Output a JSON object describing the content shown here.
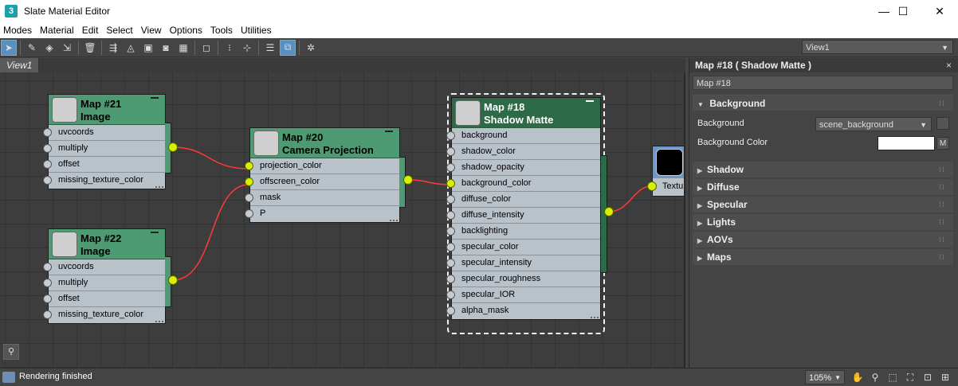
{
  "window": {
    "title": "Slate Material Editor",
    "app_icon_glyph": "3",
    "min_glyph": "—",
    "max_glyph": "☐",
    "close_glyph": "✕"
  },
  "menu": [
    "Modes",
    "Material",
    "Edit",
    "Select",
    "View",
    "Options",
    "Tools",
    "Utilities"
  ],
  "toolbar": {
    "icons": [
      "select-arrow-icon",
      "eyedropper-icon",
      "pick-material-icon",
      "assign-material-icon",
      "delete-icon",
      "move-children-icon",
      "hide-unused-icon",
      "layout-icon",
      "background-icon",
      "checker-icon",
      "show-map-icon",
      "layout-all-icon",
      "layout-children-icon",
      "material-parameters-icon",
      "navigator-icon",
      "magic-wand-icon"
    ],
    "view_select": "View1"
  },
  "view": {
    "tab_label": "View1"
  },
  "nodes": {
    "map21": {
      "title1": "Map #21",
      "title2": "Image",
      "slots": [
        "uvcoords",
        "multiply",
        "offset",
        "missing_texture_color"
      ]
    },
    "map22": {
      "title1": "Map #22",
      "title2": "Image",
      "slots": [
        "uvcoords",
        "multiply",
        "offset",
        "missing_texture_color"
      ]
    },
    "map20": {
      "title1": "Map #20",
      "title2": "Camera Projection",
      "slots": [
        "projection_color",
        "offscreen_color",
        "mask",
        "P"
      ]
    },
    "map18": {
      "title1": "Map #18",
      "title2": "Shadow Matte",
      "slots": [
        "background",
        "shadow_color",
        "shadow_opacity",
        "background_color",
        "diffuse_color",
        "diffuse_intensity",
        "backlighting",
        "specular_color",
        "specular_intensity",
        "specular_roughness",
        "specular_IOR",
        "alpha_mask"
      ]
    },
    "partial": {
      "label": "Textu"
    }
  },
  "panel": {
    "header": "Map #18  ( Shadow Matte )",
    "close": "×",
    "name_value": "Map #18",
    "background_rollout": {
      "title": "Background",
      "background_label": "Background",
      "background_value": "scene_background",
      "color_label": "Background Color",
      "color_value": "#ffffff",
      "m_button": "M"
    },
    "rollouts": [
      "Shadow",
      "Diffuse",
      "Specular",
      "Lights",
      "AOVs",
      "Maps"
    ]
  },
  "status": {
    "text": "Rendering finished",
    "zoom": "105%",
    "tools": [
      "pan-hand-icon",
      "zoom-icon",
      "zoom-region-icon",
      "zoom-extents-icon",
      "zoom-selected-icon",
      "frame-icon"
    ]
  },
  "colors": {
    "node_header": "#4e9b73",
    "node_header_selected": "#2d6a47",
    "node_body": "#b9c1c9",
    "socket_active": "#d8f000",
    "wire": "#ff3a3a",
    "output_node_header": "#6c97c6"
  }
}
